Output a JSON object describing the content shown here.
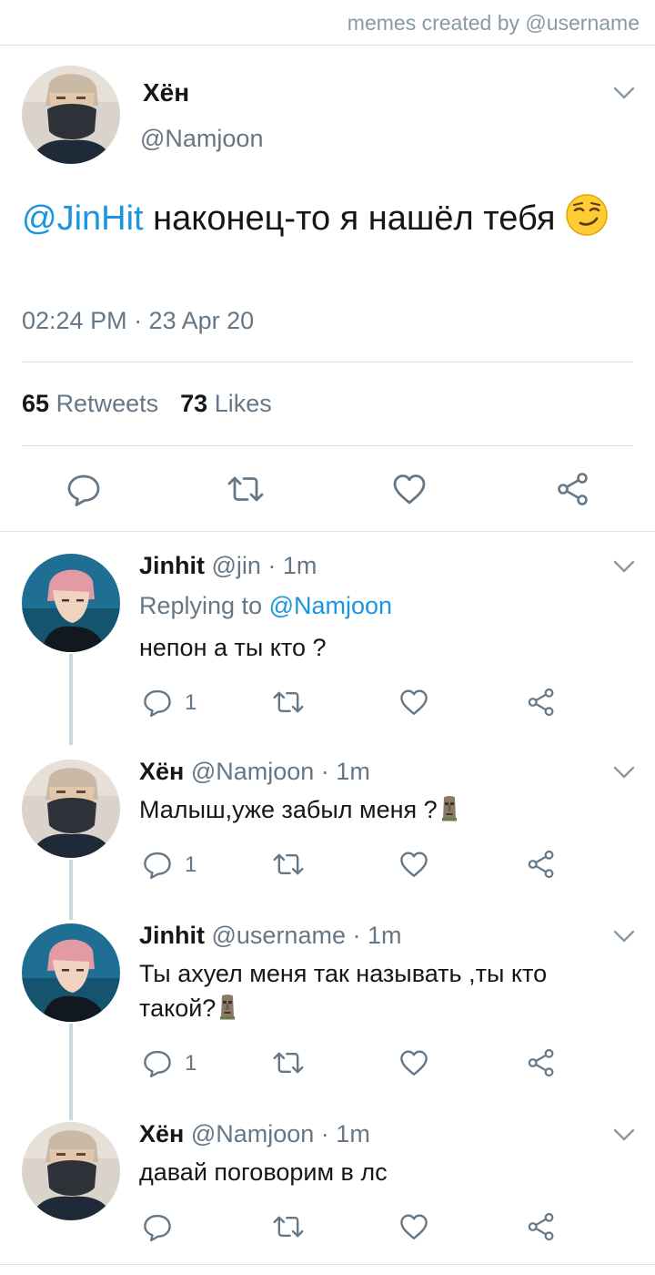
{
  "credit": "memes created by @username",
  "main_tweet": {
    "name": "Хён",
    "handle": "@Namjoon",
    "mention": "@JinHit",
    "text": " наконец-то я нашёл тебя",
    "emoji": "smirking-face",
    "timestamp": "02:24 PM · 23 Apr 20",
    "retweets_count": "65",
    "retweets_label": "Retweets",
    "likes_count": "73",
    "likes_label": "Likes"
  },
  "replies": [
    {
      "name": "Jinhit",
      "meta": " @jin · 1m",
      "replying_label": "Replying to ",
      "replying_handle": "@Namjoon",
      "text": "непон а ты кто ?",
      "reply_count": "1"
    },
    {
      "name": "Хён",
      "meta": " @Namjoon · 1m",
      "text": "Малыш,уже забыл меня ?",
      "emoji": "moai",
      "reply_count": "1"
    },
    {
      "name": "Jinhit",
      "meta": " @username · 1m",
      "text": "Ты ахуел меня так называть ,ты кто такой?",
      "emoji": "moai",
      "reply_count": "1"
    },
    {
      "name": "Хён",
      "meta": " @Namjoon · 1m",
      "text": "давай поговорим в лс",
      "reply_count": ""
    }
  ],
  "colors": {
    "link": "#1b95e0",
    "secondary_text": "#657786",
    "icon": "#657786",
    "divider": "#d9e0e6",
    "thread_line": "#ccd6dd"
  }
}
